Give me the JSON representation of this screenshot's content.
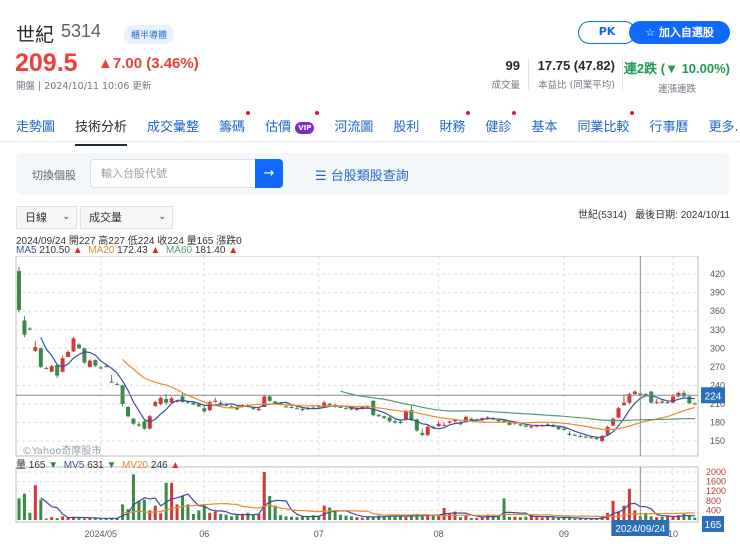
{
  "header": {
    "name": "世紀",
    "code": "5314",
    "badge": "櫃半導體",
    "price": "209.5",
    "change": "▲7.00 (3.46%)",
    "updated": "開盤 | 2024/10/11 10:06 更新",
    "pk_label": "PK",
    "watchlist_label": "加入自選股"
  },
  "stats": [
    {
      "value": "99",
      "label": "成交量"
    },
    {
      "value": "17.75 (47.82)",
      "label": "本益比 (同業平均)"
    },
    {
      "value": "連2跌 (▼ 10.00%)",
      "label": "連漲連跌"
    }
  ],
  "tabs": [
    {
      "label": "走勢圖"
    },
    {
      "label": "技術分析"
    },
    {
      "label": "成交彙整"
    },
    {
      "label": "籌碼"
    },
    {
      "label": "估價"
    },
    {
      "label": "河流圖"
    },
    {
      "label": "股利"
    },
    {
      "label": "財務"
    },
    {
      "label": "健診"
    },
    {
      "label": "基本"
    },
    {
      "label": "同業比較"
    },
    {
      "label": "行事曆"
    },
    {
      "label": "更多..."
    }
  ],
  "vip_label": "VIP",
  "search": {
    "label": "切換個股",
    "placeholder": "輸入台股代號",
    "go": "→",
    "category_link": "☰ 台股類股查詢"
  },
  "controls": {
    "period": "日線",
    "indicator": "成交量",
    "info": "世紀(5314)   最後日期: 2024/10/11"
  },
  "legend": {
    "ohlc": "2024/09/24 開227 高227 低224 收224 量165 漲跌0",
    "ma5": "MA5",
    "ma5_val": "210.50",
    "ma20": "MA20",
    "ma20_val": "172.43",
    "ma60": "MA60",
    "ma60_val": "181.40",
    "arrow_up": "▲",
    "arrow_dn": "▼",
    "vol": "量",
    "vol_val": "165",
    "mv5": "MV5",
    "mv5_val": "631",
    "mv20": "MV20",
    "mv20_val": "246"
  },
  "watermark": "©Yahoo奇摩股市",
  "colors": {
    "up": "#d0393b",
    "down": "#3a8a4a",
    "ma5": "#3d4f9a",
    "ma20": "#e88a2e",
    "ma60": "#5a9a6e",
    "accent": "#0f69ff"
  },
  "chart_data": {
    "type": "candlestick",
    "price_ticks": [
      150,
      180,
      210,
      240,
      270,
      300,
      330,
      360,
      390,
      420
    ],
    "price_range": [
      120,
      445
    ],
    "volume_ticks": [
      400,
      800,
      1200,
      1600,
      2000
    ],
    "month_labels": [
      {
        "i": 15,
        "label": "2024/05"
      },
      {
        "i": 34,
        "label": "06"
      },
      {
        "i": 55,
        "label": "07"
      },
      {
        "i": 77,
        "label": "08"
      },
      {
        "i": 100,
        "label": "09"
      },
      {
        "i": 120,
        "label": "10"
      }
    ],
    "crosshair": {
      "index": 114,
      "date": "2024/09/24",
      "price": 224,
      "price_label": "224",
      "volume_label": "165"
    },
    "candles_ohlcv": [
      [
        425,
        432,
        358,
        362,
        900
      ],
      [
        345,
        352,
        318,
        322,
        1100
      ],
      [
        332,
        334,
        329,
        331,
        300
      ],
      [
        296,
        312,
        294,
        302,
        1450
      ],
      [
        300,
        301,
        268,
        270,
        850
      ],
      [
        268,
        270,
        266,
        268,
        60
      ],
      [
        262,
        273,
        262,
        271,
        120
      ],
      [
        273,
        274,
        252,
        256,
        80
      ],
      [
        262,
        288,
        261,
        284,
        150
      ],
      [
        286,
        297,
        286,
        294,
        100
      ],
      [
        295,
        318,
        294,
        316,
        120
      ],
      [
        306,
        308,
        299,
        300,
        80
      ],
      [
        300,
        301,
        275,
        277,
        70
      ],
      [
        270,
        282,
        269,
        280,
        110
      ],
      [
        281,
        282,
        270,
        272,
        60
      ],
      [
        269,
        271,
        266,
        268,
        50
      ],
      [
        271,
        274,
        270,
        271,
        60
      ],
      [
        246,
        257,
        245,
        246,
        70
      ],
      [
        242,
        245,
        241,
        242,
        90
      ],
      [
        240,
        241,
        206,
        210,
        650
      ],
      [
        205,
        206,
        188,
        190,
        450
      ],
      [
        186,
        187,
        176,
        178,
        1900
      ],
      [
        177,
        181,
        173,
        175,
        800
      ],
      [
        182,
        183,
        168,
        170,
        850
      ],
      [
        170,
        192,
        168,
        190,
        400
      ],
      [
        207,
        215,
        205,
        213,
        600
      ],
      [
        210,
        222,
        208,
        220,
        280
      ],
      [
        218,
        226,
        208,
        212,
        1550
      ],
      [
        212,
        222,
        210,
        219,
        1550
      ],
      [
        214,
        216,
        212,
        215,
        650
      ],
      [
        222,
        228,
        212,
        213,
        1000
      ],
      [
        214,
        215,
        210,
        212,
        650
      ],
      [
        212,
        214,
        208,
        209,
        250
      ],
      [
        210,
        212,
        205,
        206,
        400
      ],
      [
        203,
        208,
        196,
        198,
        600
      ],
      [
        200,
        215,
        198,
        213,
        300
      ],
      [
        214,
        220,
        212,
        215,
        350
      ],
      [
        212,
        216,
        208,
        210,
        250
      ],
      [
        209,
        212,
        206,
        208,
        220
      ],
      [
        206,
        208,
        204,
        205,
        150
      ],
      [
        205,
        207,
        200,
        201,
        200
      ],
      [
        206,
        210,
        204,
        208,
        260
      ],
      [
        208,
        210,
        206,
        207,
        300
      ],
      [
        204,
        206,
        200,
        202,
        200
      ],
      [
        200,
        204,
        198,
        202,
        260
      ],
      [
        205,
        225,
        205,
        222,
        2000
      ],
      [
        222,
        224,
        213,
        215,
        1000
      ],
      [
        214,
        215,
        210,
        211,
        600
      ],
      [
        211,
        213,
        208,
        209,
        200
      ],
      [
        206,
        208,
        204,
        205,
        150
      ],
      [
        205,
        207,
        203,
        204,
        140
      ],
      [
        203,
        206,
        202,
        203,
        120
      ],
      [
        202,
        204,
        198,
        200,
        130
      ],
      [
        203,
        205,
        200,
        202,
        150
      ],
      [
        204,
        207,
        201,
        203,
        200
      ],
      [
        206,
        208,
        204,
        205,
        150
      ],
      [
        205,
        215,
        203,
        212,
        600
      ],
      [
        210,
        212,
        206,
        208,
        520
      ],
      [
        208,
        210,
        204,
        205,
        400
      ],
      [
        205,
        207,
        203,
        204,
        220
      ],
      [
        203,
        205,
        201,
        202,
        180
      ],
      [
        205,
        206,
        200,
        201,
        150
      ],
      [
        201,
        204,
        199,
        202,
        120
      ],
      [
        203,
        206,
        201,
        205,
        100
      ],
      [
        206,
        208,
        203,
        206,
        130
      ],
      [
        215,
        216,
        190,
        192,
        120
      ],
      [
        192,
        194,
        189,
        190,
        180
      ],
      [
        190,
        191,
        186,
        187,
        160
      ],
      [
        188,
        190,
        180,
        182,
        200
      ],
      [
        182,
        185,
        178,
        180,
        160
      ],
      [
        181,
        183,
        178,
        179,
        150
      ],
      [
        185,
        200,
        183,
        198,
        120
      ],
      [
        200,
        208,
        182,
        185,
        200
      ],
      [
        185,
        186,
        165,
        167,
        250
      ],
      [
        163,
        170,
        158,
        160,
        150
      ],
      [
        160,
        175,
        158,
        173,
        230
      ],
      [
        173,
        175,
        170,
        171,
        180
      ],
      [
        174,
        182,
        173,
        178,
        220
      ],
      [
        175,
        180,
        174,
        176,
        500
      ],
      [
        180,
        183,
        178,
        182,
        250
      ],
      [
        182,
        186,
        180,
        184,
        350
      ],
      [
        180,
        182,
        176,
        177,
        120
      ],
      [
        182,
        191,
        180,
        189,
        220
      ],
      [
        186,
        188,
        182,
        184,
        80
      ],
      [
        184,
        186,
        182,
        185,
        90
      ],
      [
        185,
        188,
        182,
        187,
        100
      ],
      [
        186,
        190,
        184,
        188,
        220
      ],
      [
        187,
        189,
        184,
        185,
        200
      ],
      [
        184,
        186,
        180,
        182,
        150
      ],
      [
        183,
        185,
        180,
        181,
        900
      ],
      [
        180,
        182,
        175,
        176,
        130
      ],
      [
        178,
        181,
        176,
        180,
        140
      ],
      [
        177,
        180,
        174,
        175,
        120
      ],
      [
        175,
        177,
        172,
        173,
        140
      ],
      [
        172,
        175,
        170,
        174,
        220
      ],
      [
        174,
        176,
        172,
        175,
        120
      ],
      [
        175,
        177,
        173,
        176,
        100
      ],
      [
        176,
        179,
        174,
        177,
        130
      ],
      [
        176,
        178,
        172,
        173,
        120
      ],
      [
        173,
        175,
        168,
        169,
        100
      ],
      [
        170,
        172,
        167,
        168,
        90
      ],
      [
        162,
        166,
        158,
        160,
        80
      ],
      [
        160,
        162,
        158,
        159,
        60
      ],
      [
        158,
        161,
        156,
        158,
        70
      ],
      [
        157,
        159,
        155,
        156,
        60
      ],
      [
        156,
        158,
        154,
        155,
        50
      ],
      [
        155,
        157,
        152,
        153,
        60
      ],
      [
        150,
        160,
        148,
        158,
        150
      ],
      [
        160,
        175,
        159,
        173,
        300
      ],
      [
        175,
        188,
        174,
        186,
        800
      ],
      [
        188,
        205,
        187,
        203,
        350
      ],
      [
        208,
        225,
        207,
        212,
        600
      ],
      [
        212,
        228,
        210,
        226,
        1300
      ],
      [
        226,
        232,
        225,
        230,
        400
      ],
      [
        227,
        227,
        224,
        224,
        165
      ],
      [
        226,
        228,
        222,
        225,
        300
      ],
      [
        230,
        231,
        210,
        212,
        150
      ],
      [
        212,
        218,
        210,
        213,
        120
      ],
      [
        214,
        216,
        210,
        212,
        130
      ],
      [
        212,
        215,
        210,
        213,
        150
      ],
      [
        212,
        226,
        211,
        222,
        150
      ],
      [
        222,
        230,
        221,
        228,
        200
      ],
      [
        228,
        232,
        220,
        222,
        250
      ],
      [
        222,
        224,
        210,
        211,
        180
      ],
      [
        211,
        212,
        208,
        209.5,
        99
      ]
    ]
  }
}
